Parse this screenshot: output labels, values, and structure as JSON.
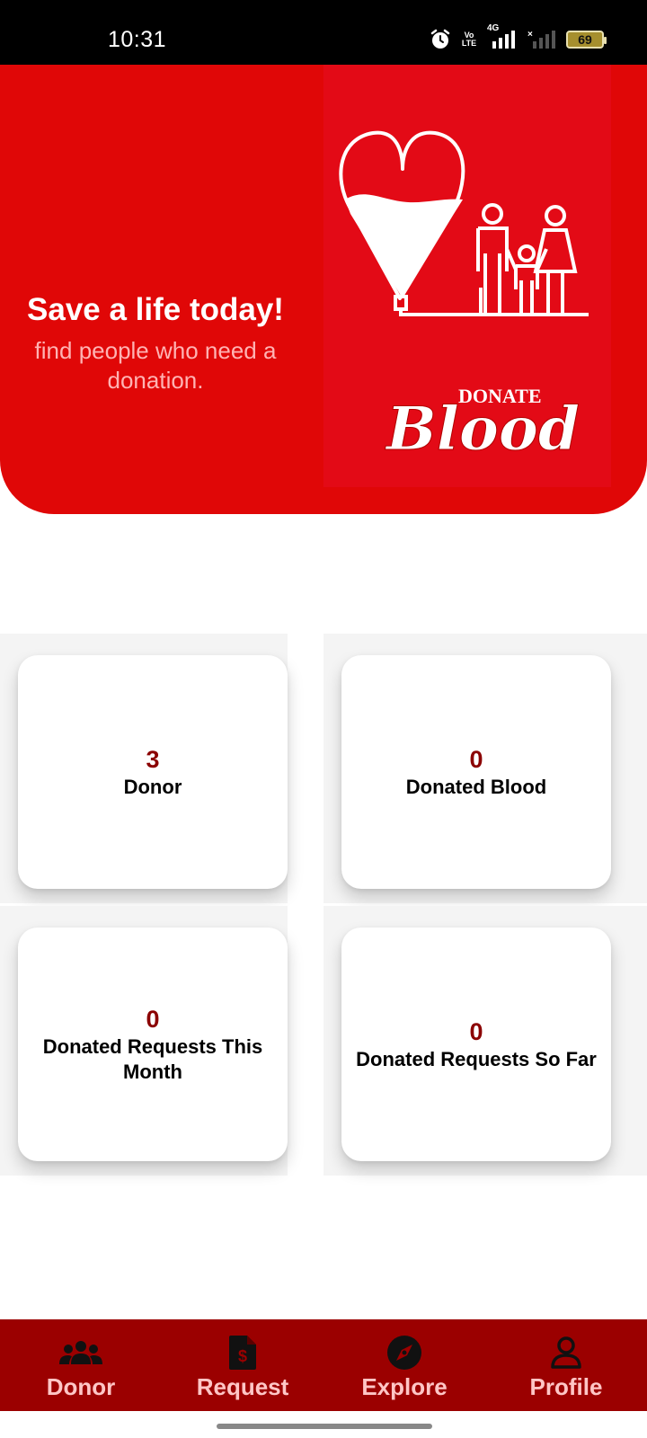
{
  "status_bar": {
    "time": "10:31",
    "volte_label": "Vo LTE",
    "network_label": "4G",
    "battery_level": "69",
    "icons": [
      "alarm-icon",
      "volte-icon",
      "signal-4g-icon",
      "signal-no-service-icon",
      "battery-icon"
    ]
  },
  "hero": {
    "title": "Save a life today!",
    "subtitle": "find people who need a donation.",
    "logo_small_text": "DONATE",
    "logo_script_text": "Blood",
    "background_color": "#e00707"
  },
  "stats": [
    {
      "value": "3",
      "label": "Donor"
    },
    {
      "value": "0",
      "label": "Donated Blood"
    },
    {
      "value": "0",
      "label": "Donated Requests This Month"
    },
    {
      "value": "0",
      "label": "Donated Requests So Far"
    }
  ],
  "nav": {
    "items": [
      {
        "label": "Donor",
        "icon": "users-icon"
      },
      {
        "label": "Request",
        "icon": "dollar-document-icon"
      },
      {
        "label": "Explore",
        "icon": "compass-icon"
      },
      {
        "label": "Profile",
        "icon": "user-icon"
      }
    ],
    "background_color": "#9b0000"
  },
  "colors": {
    "accent_red": "#e00707",
    "value_dark_red": "#8b0000"
  }
}
